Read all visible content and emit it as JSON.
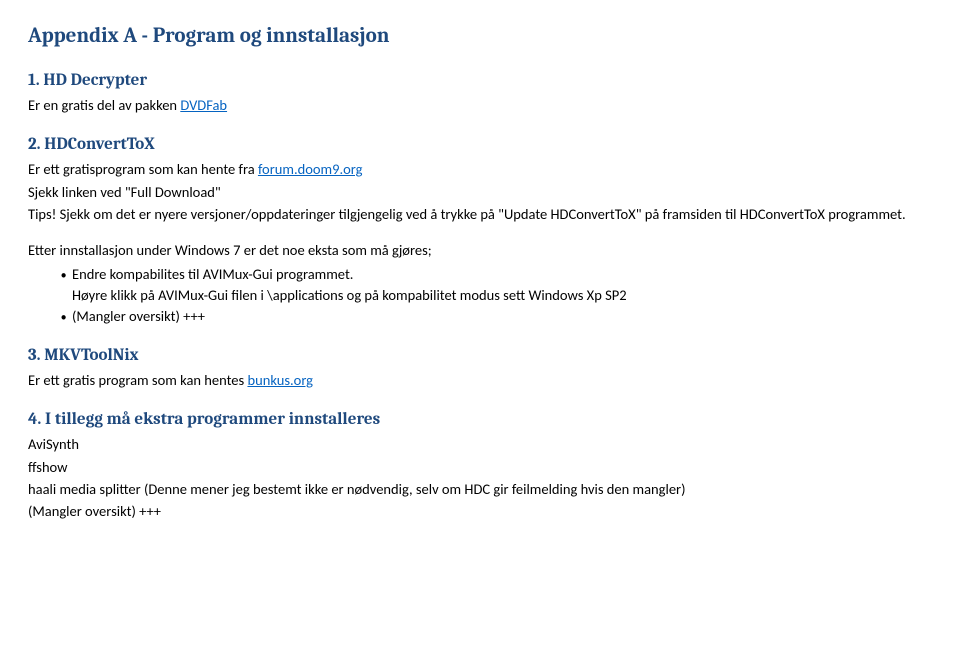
{
  "title": "Appendix A - Program og innstallasjon",
  "s1": {
    "heading": "1. HD Decrypter",
    "text_a": "Er en gratis del av pakken ",
    "link": "DVDFab"
  },
  "s2": {
    "heading": "2. HDConvertToX",
    "line1_a": "Er ett gratisprogram som kan hente fra ",
    "link": "forum.doom9.org",
    "line2": "Sjekk linken ved \"Full Download\"",
    "line3": "Tips! Sjekk om det er nyere versjoner/oppdateringer tilgjengelig ved å trykke på \"Update HDConvertToX\" på framsiden til HDConvertToX programmet.",
    "intro2": "Etter  innstallasjon under Windows 7 er det noe eksta som må gjøres;",
    "bullets": [
      "Endre kompabilites til AVIMux-Gui programmet.",
      "Høyre klikk på AVIMux-Gui filen i \\applications og på kompabilitet modus sett Windows Xp SP2",
      "(Mangler oversikt) +++"
    ]
  },
  "s3": {
    "heading": "3. MKVToolNix",
    "text_a": "Er ett gratis program som kan hentes ",
    "link": "bunkus.org"
  },
  "s4": {
    "heading": "4. I tillegg må ekstra programmer innstalleres",
    "line1": "AviSynth",
    "line2": "ffshow",
    "line3": "haali media splitter (Denne mener jeg bestemt ikke er nødvendig, selv om HDC gir feilmelding hvis den mangler)",
    "line4": "(Mangler oversikt) +++"
  }
}
